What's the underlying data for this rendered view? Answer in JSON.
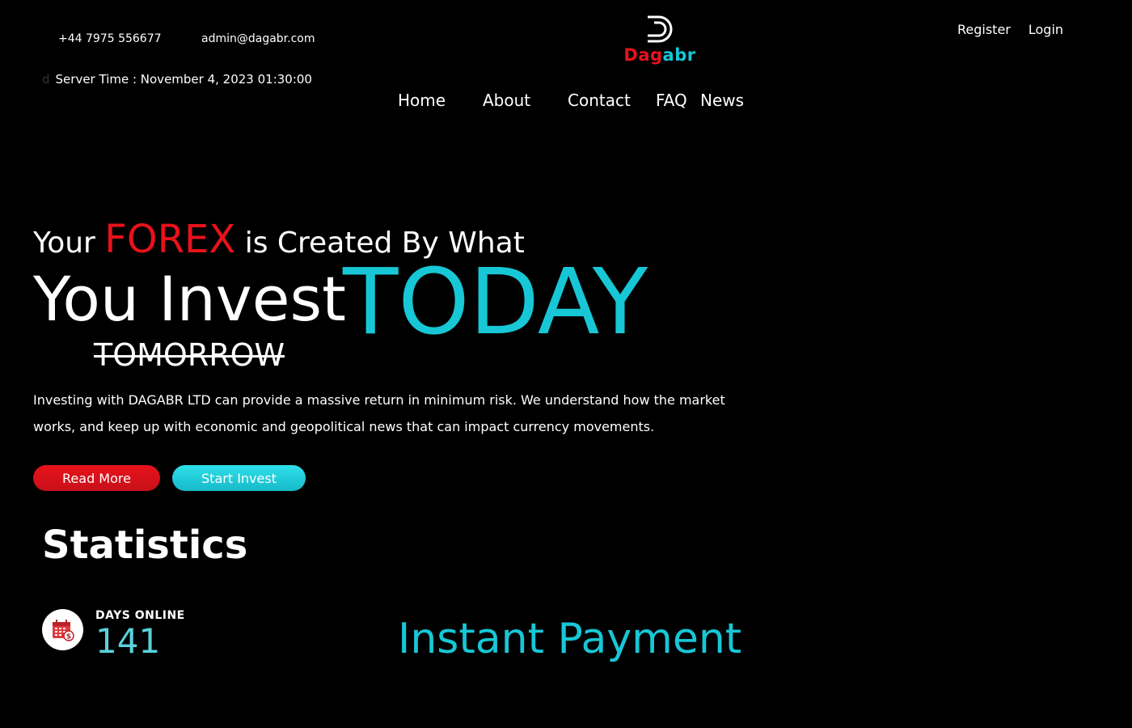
{
  "topbar": {
    "phone": "+44 7975 556677",
    "email": "admin@dagabr.com",
    "server_time_glyph": "d",
    "server_time": "Server Time : November 4, 2023 01:30:00"
  },
  "logo": {
    "icon": "d-logo-icon",
    "word_red": "Dag",
    "word_cyan": "abr"
  },
  "auth": {
    "register": "Register",
    "login": "Login"
  },
  "nav": {
    "items": [
      "Home",
      "About",
      "Contact",
      "FAQ",
      "News"
    ]
  },
  "hero": {
    "line1_pre": "Your ",
    "line1_highlight": "FOREX",
    "line1_post": " is Created By What",
    "line2": "You Invest",
    "today": "TODAY",
    "struck": "TOMORROW",
    "description": "Investing with DAGABR LTD can provide a massive return in minimum risk. We understand how the market works, and keep up with economic and geopolitical news that can impact currency movements.",
    "read_more": "Read More",
    "start_invest": "Start Invest"
  },
  "stats": {
    "title": "Statistics",
    "days_online_label": "DAYS ONLINE",
    "days_online_value": "141",
    "icon": "calendar-money-icon",
    "instant_payment": "Instant Payment"
  },
  "colors": {
    "accent_red": "#e8121a",
    "accent_cyan": "#17c7d6",
    "background": "#000000"
  }
}
